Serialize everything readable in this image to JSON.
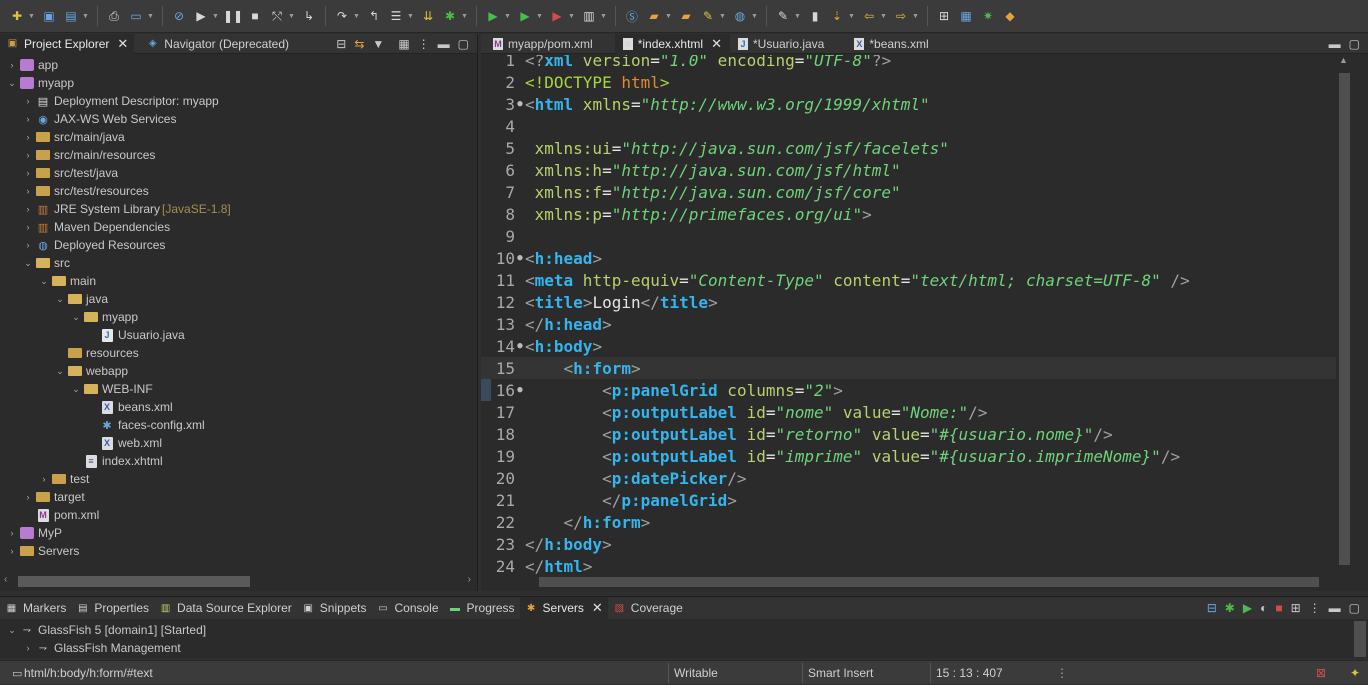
{
  "toolbar": {
    "icons": [
      "new-icon",
      "save-icon",
      "save-all-icon",
      "print-icon",
      "toggle-mark-icon",
      "skip-breakpoints-icon",
      "resume-icon",
      "suspend-icon",
      "terminate-icon",
      "disconnect-icon",
      "step-into-icon",
      "step-over-icon",
      "step-return-icon",
      "drop-frame-icon",
      "use-step-filters-icon",
      "debug-icon",
      "run-icon",
      "coverage-icon",
      "external-tools-icon",
      "new-package-icon",
      "new-class-icon",
      "open-type-icon",
      "open-task-icon",
      "search-icon",
      "globe-icon",
      "annotation-icon",
      "prev-annotation-icon",
      "next-annotation-icon",
      "back-icon",
      "forward-icon",
      "open-perspective-icon",
      "java-ee-perspective-icon",
      "debug-perspective-icon",
      "git-perspective-icon"
    ]
  },
  "left_panel": {
    "tabs": [
      {
        "label": "Project Explorer",
        "active": true
      },
      {
        "label": "Navigator (Deprecated)",
        "active": false
      }
    ]
  },
  "tree": [
    {
      "label": "app",
      "indent": 0,
      "arrow": "›",
      "icon": "project"
    },
    {
      "label": "myapp",
      "indent": 0,
      "arrow": "⌄",
      "icon": "project"
    },
    {
      "label": "Deployment Descriptor: myapp",
      "indent": 1,
      "arrow": "›",
      "icon": "descriptor"
    },
    {
      "label": "JAX-WS Web Services",
      "indent": 1,
      "arrow": "›",
      "icon": "webservice"
    },
    {
      "label": "src/main/java",
      "indent": 1,
      "arrow": "›",
      "icon": "package-folder"
    },
    {
      "label": "src/main/resources",
      "indent": 1,
      "arrow": "›",
      "icon": "package-folder"
    },
    {
      "label": "src/test/java",
      "indent": 1,
      "arrow": "›",
      "icon": "package-folder"
    },
    {
      "label": "src/test/resources",
      "indent": 1,
      "arrow": "›",
      "icon": "package-folder"
    },
    {
      "label": "JRE System Library",
      "sub": "[JavaSE-1.8]",
      "indent": 1,
      "arrow": "›",
      "icon": "library"
    },
    {
      "label": "Maven Dependencies",
      "indent": 1,
      "arrow": "›",
      "icon": "library"
    },
    {
      "label": "Deployed Resources",
      "indent": 1,
      "arrow": "›",
      "icon": "deployed"
    },
    {
      "label": "src",
      "indent": 1,
      "arrow": "⌄",
      "icon": "folder-open"
    },
    {
      "label": "main",
      "indent": 2,
      "arrow": "⌄",
      "icon": "folder-open"
    },
    {
      "label": "java",
      "indent": 3,
      "arrow": "⌄",
      "icon": "folder-open"
    },
    {
      "label": "myapp",
      "indent": 4,
      "arrow": "⌄",
      "icon": "folder-open"
    },
    {
      "label": "Usuario.java",
      "indent": 5,
      "arrow": "",
      "icon": "java-file"
    },
    {
      "label": "resources",
      "indent": 3,
      "arrow": "",
      "icon": "folder"
    },
    {
      "label": "webapp",
      "indent": 3,
      "arrow": "⌄",
      "icon": "folder-open"
    },
    {
      "label": "WEB-INF",
      "indent": 4,
      "arrow": "⌄",
      "icon": "folder-open"
    },
    {
      "label": "beans.xml",
      "indent": 5,
      "arrow": "",
      "icon": "xml-file"
    },
    {
      "label": "faces-config.xml",
      "indent": 5,
      "arrow": "",
      "icon": "faces-file"
    },
    {
      "label": "web.xml",
      "indent": 5,
      "arrow": "",
      "icon": "xml-file"
    },
    {
      "label": "index.xhtml",
      "indent": 4,
      "arrow": "",
      "icon": "page-file"
    },
    {
      "label": "test",
      "indent": 2,
      "arrow": "›",
      "icon": "folder"
    },
    {
      "label": "target",
      "indent": 1,
      "arrow": "›",
      "icon": "folder"
    },
    {
      "label": "pom.xml",
      "indent": 1,
      "arrow": "",
      "icon": "maven-file"
    },
    {
      "label": "MyP",
      "indent": 0,
      "arrow": "›",
      "icon": "project"
    },
    {
      "label": "Servers",
      "indent": 0,
      "arrow": "›",
      "icon": "folder"
    }
  ],
  "editor": {
    "tabs": [
      {
        "label": "myapp/pom.xml",
        "active": false,
        "icon": "maven"
      },
      {
        "label": "*index.xhtml",
        "active": true,
        "icon": "page"
      },
      {
        "label": "*Usuario.java",
        "active": false,
        "icon": "java"
      },
      {
        "label": "*beans.xml",
        "active": false,
        "icon": "xml"
      }
    ],
    "lines": [
      {
        "n": "1",
        "fold": "",
        "segs": [
          [
            "tg",
            "<?"
          ],
          [
            "tn",
            "xml"
          ],
          [
            "at",
            " version"
          ],
          [
            "tx",
            "="
          ],
          [
            "av",
            "\"1.0\""
          ],
          [
            "at",
            " encoding"
          ],
          [
            "tx",
            "="
          ],
          [
            "av",
            "\"UTF-8\""
          ],
          [
            "tg",
            "?>"
          ]
        ]
      },
      {
        "n": "2",
        "fold": "",
        "segs": [
          [
            "dt",
            "<!DOCTYPE"
          ],
          [
            "dtn",
            " html"
          ],
          [
            "dt",
            ">"
          ]
        ]
      },
      {
        "n": "3",
        "fold": "●",
        "segs": [
          [
            "tg",
            "<"
          ],
          [
            "tn",
            "html"
          ],
          [
            "at",
            " xmlns"
          ],
          [
            "tx",
            "="
          ],
          [
            "av",
            "\"http://www.w3.org/1999/xhtml\""
          ]
        ]
      },
      {
        "n": "4",
        "fold": "",
        "segs": []
      },
      {
        "n": "5",
        "fold": "",
        "segs": [
          [
            "at",
            " xmlns:ui"
          ],
          [
            "tx",
            "="
          ],
          [
            "av",
            "\"http://java.sun.com/jsf/facelets\""
          ]
        ]
      },
      {
        "n": "6",
        "fold": "",
        "segs": [
          [
            "at",
            " xmlns:h"
          ],
          [
            "tx",
            "="
          ],
          [
            "av",
            "\"http://java.sun.com/jsf/html\""
          ]
        ]
      },
      {
        "n": "7",
        "fold": "",
        "segs": [
          [
            "at",
            " xmlns:f"
          ],
          [
            "tx",
            "="
          ],
          [
            "av",
            "\"http://java.sun.com/jsf/core\""
          ]
        ]
      },
      {
        "n": "8",
        "fold": "",
        "segs": [
          [
            "at",
            " xmlns:p"
          ],
          [
            "tx",
            "="
          ],
          [
            "av",
            "\"http://primefaces.org/ui\""
          ],
          [
            "tg",
            ">"
          ]
        ]
      },
      {
        "n": "9",
        "fold": "",
        "segs": []
      },
      {
        "n": "10",
        "fold": "●",
        "segs": [
          [
            "tg",
            "<"
          ],
          [
            "tn",
            "h:head"
          ],
          [
            "tg",
            ">"
          ]
        ]
      },
      {
        "n": "11",
        "fold": "",
        "segs": [
          [
            "tg",
            "<"
          ],
          [
            "tn",
            "meta"
          ],
          [
            "at",
            " http-equiv"
          ],
          [
            "tx",
            "="
          ],
          [
            "av",
            "\"Content-Type\""
          ],
          [
            "at",
            " content"
          ],
          [
            "tx",
            "="
          ],
          [
            "av",
            "\"text/html; charset=UTF-8\""
          ],
          [
            "tg",
            " />"
          ]
        ]
      },
      {
        "n": "12",
        "fold": "",
        "segs": [
          [
            "tg",
            "<"
          ],
          [
            "tn",
            "title"
          ],
          [
            "tg",
            ">"
          ],
          [
            "tx",
            "Login"
          ],
          [
            "tg",
            "</"
          ],
          [
            "tn",
            "title"
          ],
          [
            "tg",
            ">"
          ]
        ]
      },
      {
        "n": "13",
        "fold": "",
        "segs": [
          [
            "tg",
            "</"
          ],
          [
            "tn",
            "h:head"
          ],
          [
            "tg",
            ">"
          ]
        ]
      },
      {
        "n": "14",
        "fold": "●",
        "segs": [
          [
            "tg",
            "<"
          ],
          [
            "tn",
            "h:body"
          ],
          [
            "tg",
            ">"
          ]
        ]
      },
      {
        "n": "15",
        "fold": "",
        "current": true,
        "segs": [
          [
            "tx",
            "    "
          ],
          [
            "tg",
            "<"
          ],
          [
            "tn",
            "h:form"
          ],
          [
            "tg",
            ">"
          ]
        ]
      },
      {
        "n": "16",
        "fold": "●",
        "segs": [
          [
            "tx",
            "        "
          ],
          [
            "tg",
            "<"
          ],
          [
            "tn",
            "p:panelGrid"
          ],
          [
            "at",
            " columns"
          ],
          [
            "tx",
            "="
          ],
          [
            "av",
            "\"2\""
          ],
          [
            "tg",
            ">"
          ]
        ]
      },
      {
        "n": "17",
        "fold": "",
        "segs": [
          [
            "tx",
            "        "
          ],
          [
            "tg",
            "<"
          ],
          [
            "tn",
            "p:outputLabel"
          ],
          [
            "at",
            " id"
          ],
          [
            "tx",
            "="
          ],
          [
            "av",
            "\"nome\""
          ],
          [
            "at",
            " value"
          ],
          [
            "tx",
            "="
          ],
          [
            "av",
            "\"Nome:\""
          ],
          [
            "tg",
            "/>"
          ]
        ]
      },
      {
        "n": "18",
        "fold": "",
        "segs": [
          [
            "tx",
            "        "
          ],
          [
            "tg",
            "<"
          ],
          [
            "tn",
            "p:outputLabel"
          ],
          [
            "at",
            " id"
          ],
          [
            "tx",
            "="
          ],
          [
            "av",
            "\"retorno\""
          ],
          [
            "at",
            " value"
          ],
          [
            "tx",
            "="
          ],
          [
            "av",
            "\"#{usuario.nome}\""
          ],
          [
            "tg",
            "/>"
          ]
        ]
      },
      {
        "n": "19",
        "fold": "",
        "segs": [
          [
            "tx",
            "        "
          ],
          [
            "tg",
            "<"
          ],
          [
            "tn",
            "p:outputLabel"
          ],
          [
            "at",
            " id"
          ],
          [
            "tx",
            "="
          ],
          [
            "av",
            "\"imprime\""
          ],
          [
            "at",
            " value"
          ],
          [
            "tx",
            "="
          ],
          [
            "av",
            "\"#{usuario.imprimeNome}\""
          ],
          [
            "tg",
            "/>"
          ]
        ]
      },
      {
        "n": "20",
        "fold": "",
        "segs": [
          [
            "tx",
            "        "
          ],
          [
            "tg",
            "<"
          ],
          [
            "tn",
            "p:datePicker"
          ],
          [
            "tg",
            "/>"
          ]
        ]
      },
      {
        "n": "21",
        "fold": "",
        "segs": [
          [
            "tx",
            "        "
          ],
          [
            "tg",
            "</"
          ],
          [
            "tn",
            "p:panelGrid"
          ],
          [
            "tg",
            ">"
          ]
        ]
      },
      {
        "n": "22",
        "fold": "",
        "segs": [
          [
            "tx",
            "    "
          ],
          [
            "tg",
            "</"
          ],
          [
            "tn",
            "h:form"
          ],
          [
            "tg",
            ">"
          ]
        ]
      },
      {
        "n": "23",
        "fold": "",
        "segs": [
          [
            "tg",
            "</"
          ],
          [
            "tn",
            "h:body"
          ],
          [
            "tg",
            ">"
          ]
        ]
      },
      {
        "n": "24",
        "fold": "",
        "segs": [
          [
            "tg",
            "</"
          ],
          [
            "tn",
            "html"
          ],
          [
            "tg",
            ">"
          ]
        ]
      }
    ]
  },
  "bottom_panel": {
    "tabs": [
      {
        "label": "Markers",
        "active": false
      },
      {
        "label": "Properties",
        "active": false
      },
      {
        "label": "Data Source Explorer",
        "active": false
      },
      {
        "label": "Snippets",
        "active": false
      },
      {
        "label": "Console",
        "active": false
      },
      {
        "label": "Progress",
        "active": false
      },
      {
        "label": "Servers",
        "active": true
      },
      {
        "label": "Coverage",
        "active": false
      }
    ],
    "servers": [
      {
        "label": "GlassFish 5 [domain1]  [Started]",
        "arrow": "⌄",
        "indent": 0
      },
      {
        "label": "GlassFish Management",
        "arrow": "›",
        "indent": 1
      }
    ]
  },
  "status": {
    "path": "html/h:body/h:form/#text",
    "writable": "Writable",
    "insert_mode": "Smart Insert",
    "position": "15 : 13 : 407"
  },
  "colors": {
    "tag_name": "#33b5ee",
    "attribute": "#b6d16e",
    "attr_value": "#6fd37a",
    "background": "#2b2b2b"
  }
}
